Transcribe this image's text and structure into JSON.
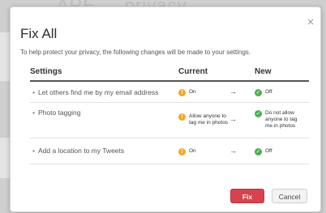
{
  "background_text": "ARE ... privacy ...",
  "dialog": {
    "title": "Fix All",
    "subtitle": "To help protect your privacy, the following changes will be made to your settings.",
    "close_glyph": "×"
  },
  "table": {
    "headers": {
      "settings": "Settings",
      "current": "Current",
      "new": "New"
    },
    "rows": [
      {
        "label": "Let others find me by my email address",
        "current": "On",
        "new": "Off"
      },
      {
        "label": "Photo tagging",
        "current": "Allow anyone to tag me in photos",
        "new": "Do not allow anyone to tag me in photos"
      },
      {
        "label": "Add a location to my Tweets",
        "current": "On",
        "new": "Off"
      }
    ],
    "arrow_glyph": "→",
    "bullet_glyph": "•",
    "warn_glyph": "!",
    "ok_glyph": "✓"
  },
  "buttons": {
    "fix": "Fix",
    "cancel": "Cancel"
  },
  "colors": {
    "fix_button": "#d6434e",
    "warning": "#f5a623",
    "ok": "#4caf50"
  },
  "icons": {
    "close": "close-icon",
    "warning": "warning-icon",
    "check": "check-icon",
    "arrow": "arrow-right-icon"
  }
}
